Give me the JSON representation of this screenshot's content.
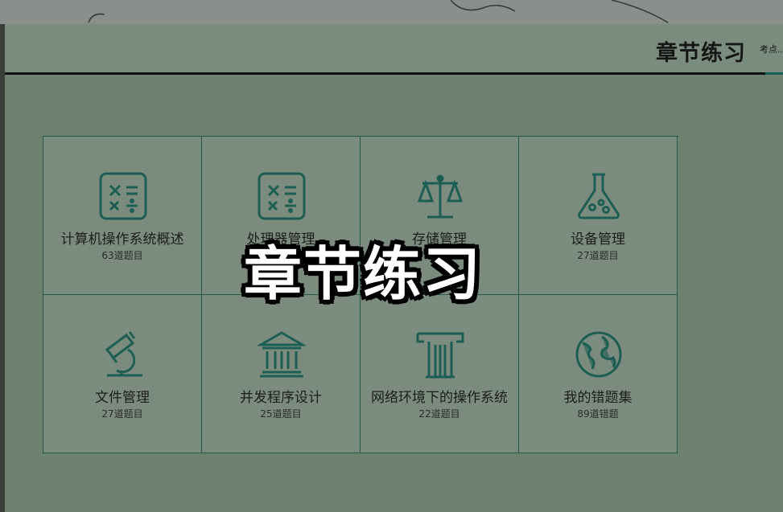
{
  "header": {
    "title": "章节练习",
    "subnav": "考点..."
  },
  "cards": [
    {
      "title": "计算机操作系统概述",
      "count": "63道题目",
      "icon": "calculator-icon"
    },
    {
      "title": "处理器管理",
      "count": "道题目",
      "icon": "calculator-icon"
    },
    {
      "title": "存储管理",
      "count": "道题目",
      "icon": "scale-icon"
    },
    {
      "title": "设备管理",
      "count": "27道题目",
      "icon": "flask-icon"
    },
    {
      "title": "文件管理",
      "count": "27道题目",
      "icon": "microscope-icon"
    },
    {
      "title": "并发程序设计",
      "count": "25道题目",
      "icon": "bank-icon"
    },
    {
      "title": "网络环境下的操作系统",
      "count": "22道题目",
      "icon": "pillar-icon"
    },
    {
      "title": "我的错题集",
      "count": "89道错题",
      "icon": "globe-icon"
    }
  ],
  "overlay": {
    "text": "章节练习"
  },
  "colors": {
    "accent": "#1d5e54",
    "background": "#6e8270",
    "card": "#7b8c7e"
  }
}
